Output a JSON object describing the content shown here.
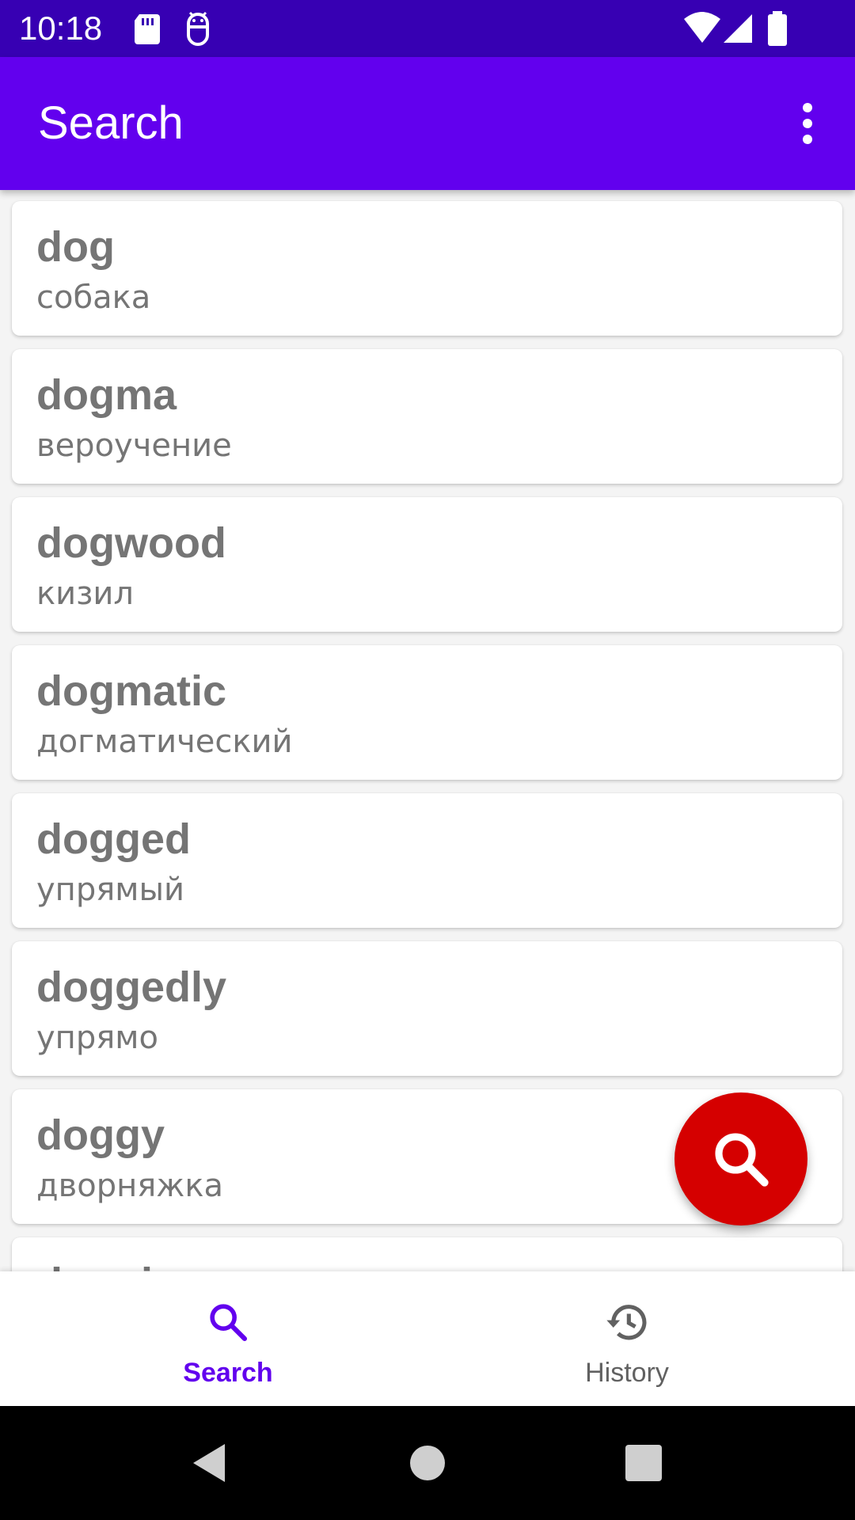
{
  "status_bar": {
    "time": "10:18",
    "icons": [
      "sd-card-icon",
      "android-debug-icon",
      "wifi-icon",
      "signal-icon",
      "battery-icon"
    ],
    "background": "#3700b3"
  },
  "app_bar": {
    "title": "Search",
    "background": "#6200ee",
    "menu_icon": "more-vert-icon"
  },
  "results": [
    {
      "word": "dog",
      "translation": "собака"
    },
    {
      "word": "dogma",
      "translation": "вероучение"
    },
    {
      "word": "dogwood",
      "translation": "кизил"
    },
    {
      "word": "dogmatic",
      "translation": "догматический"
    },
    {
      "word": "dogged",
      "translation": "упрямый"
    },
    {
      "word": "doggedly",
      "translation": "упрямо"
    },
    {
      "word": "doggy",
      "translation": "дворняжка"
    },
    {
      "word": "dogging",
      "translation": ""
    }
  ],
  "fab": {
    "icon": "search-icon",
    "color": "#d50000"
  },
  "bottom_nav": {
    "items": [
      {
        "label": "Search",
        "icon": "search-icon",
        "active": true
      },
      {
        "label": "History",
        "icon": "history-icon",
        "active": false
      }
    ],
    "active_color": "#6200ee",
    "inactive_color": "#616161"
  },
  "system_nav": {
    "buttons": [
      "back-icon",
      "home-icon",
      "recents-icon"
    ]
  }
}
